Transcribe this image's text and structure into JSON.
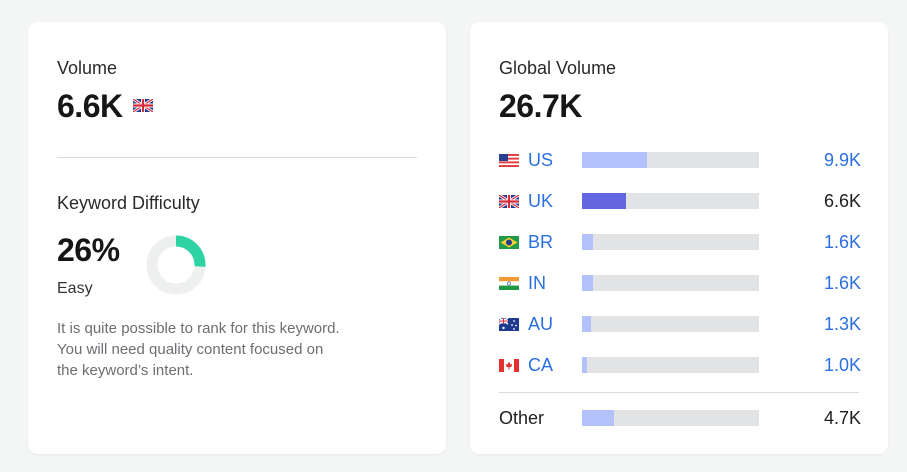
{
  "volume": {
    "label": "Volume",
    "value": "6.6K",
    "flag_icon": "uk-flag-icon"
  },
  "keyword_difficulty": {
    "label": "Keyword Difficulty",
    "value": "26%",
    "percent": 26,
    "level": "Easy",
    "gauge_color": "#2ed3a4",
    "track_color": "#eeefef",
    "description_lines": [
      "It is quite possible to rank for this keyword.",
      "You will need quality content focused on",
      "the keyword’s intent."
    ]
  },
  "global_volume": {
    "label": "Global Volume",
    "value": "26.7K",
    "countries": [
      {
        "code": "US",
        "flag_icon": "us-flag-icon",
        "value": "9.9K",
        "fill_fraction": 0.37,
        "color": "#b3c2fb",
        "link": true
      },
      {
        "code": "UK",
        "flag_icon": "uk-flag-icon",
        "value": "6.6K",
        "fill_fraction": 0.25,
        "color": "#6366e0",
        "link": false
      },
      {
        "code": "BR",
        "flag_icon": "br-flag-icon",
        "value": "1.6K",
        "fill_fraction": 0.06,
        "color": "#b3c2fb",
        "link": true
      },
      {
        "code": "IN",
        "flag_icon": "in-flag-icon",
        "value": "1.6K",
        "fill_fraction": 0.06,
        "color": "#b3c2fb",
        "link": true
      },
      {
        "code": "AU",
        "flag_icon": "au-flag-icon",
        "value": "1.3K",
        "fill_fraction": 0.05,
        "color": "#b3c2fb",
        "link": true
      },
      {
        "code": "CA",
        "flag_icon": "ca-flag-icon",
        "value": "1.0K",
        "fill_fraction": 0.03,
        "color": "#b3c2fb",
        "link": true
      }
    ],
    "other": {
      "label": "Other",
      "value": "4.7K",
      "fill_fraction": 0.18,
      "color": "#b3c2fb"
    }
  }
}
